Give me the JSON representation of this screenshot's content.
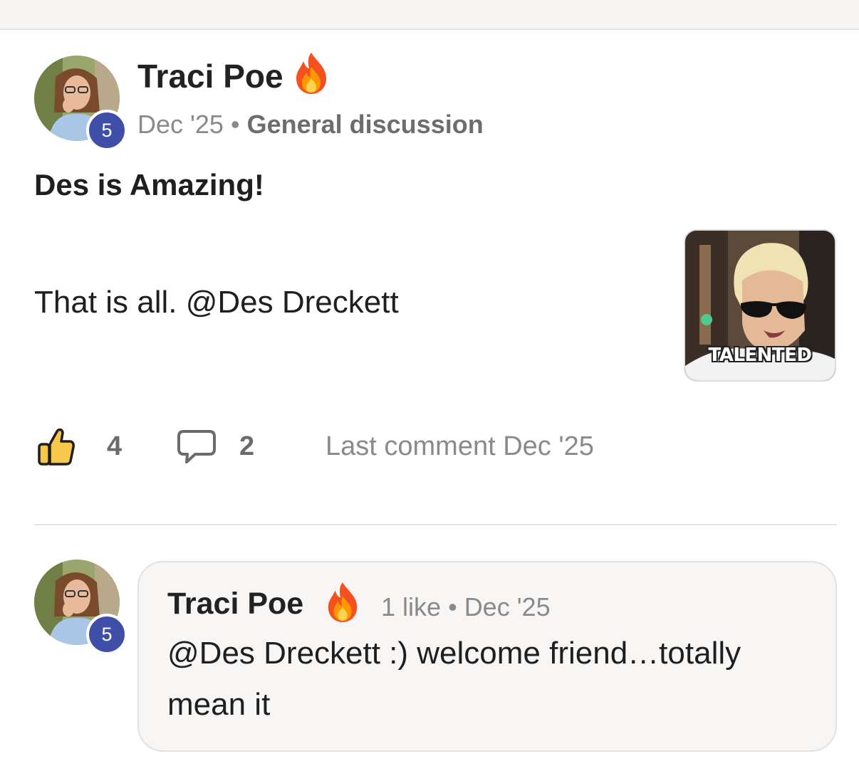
{
  "post": {
    "author": {
      "name": "Traci Poe",
      "level": "5",
      "badge_icon": "fire-icon"
    },
    "date": "Dec '25",
    "separator": "•",
    "category": "General discussion",
    "title": "Des is Amazing!",
    "body": "That is all. @Des Dreckett",
    "gif_caption": "TALENTED",
    "likes": "4",
    "comments": "2",
    "last_comment": "Last comment Dec '25"
  },
  "comment": {
    "author": {
      "name": "Traci Poe",
      "level": "5",
      "badge_icon": "fire-icon"
    },
    "likes_text": "1 like",
    "separator": "•",
    "date": "Dec '25",
    "text": "@Des Dreckett :) welcome friend…totally mean it"
  },
  "colors": {
    "level_badge": "#3f4fa8",
    "muted_text": "#8a8a8a",
    "like_icon_fill": "#f7c74b"
  }
}
